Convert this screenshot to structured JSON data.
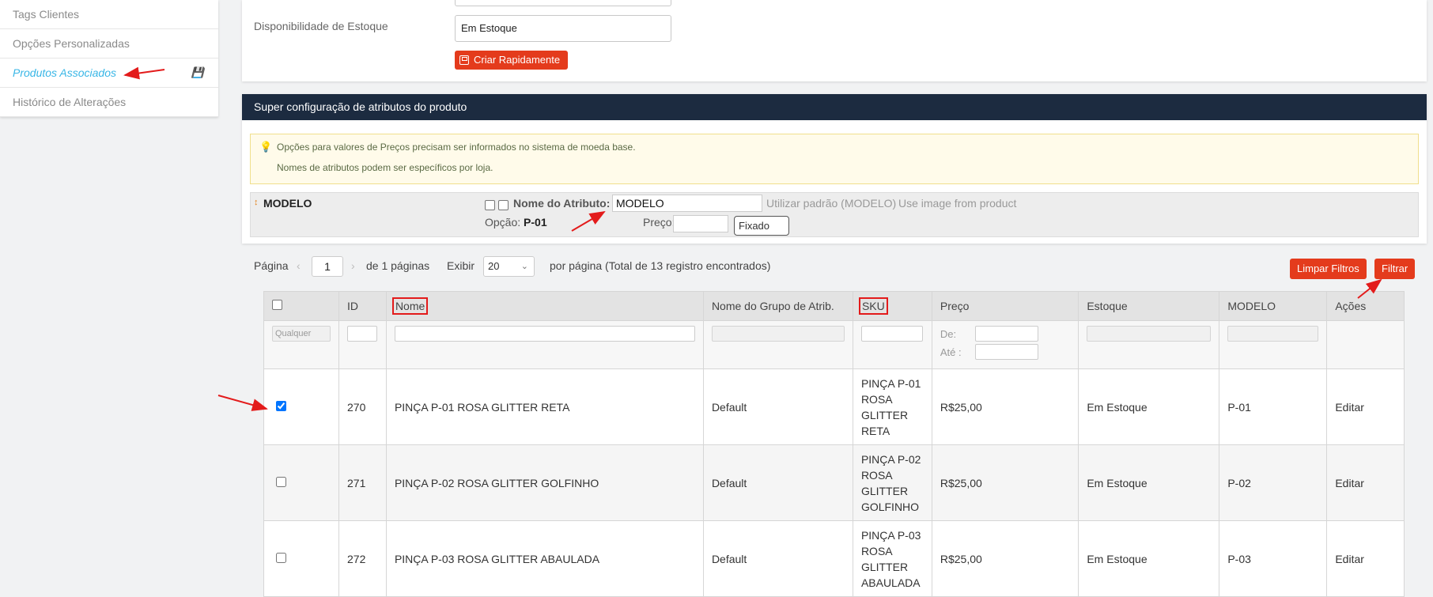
{
  "sidebar": {
    "items": [
      {
        "label": "Tags Clientes"
      },
      {
        "label": "Opções Personalizadas"
      },
      {
        "label": "Produtos Associados",
        "active": true
      },
      {
        "label": "Histórico de Alterações"
      }
    ]
  },
  "form": {
    "stock_label": "Disponibilidade de Estoque",
    "stock_value": "Em Estoque",
    "quick_create_label": "Criar Rapidamente"
  },
  "super_config": {
    "title": "Super configuração de atributos do produto",
    "notice_line1": "Opções para valores de Preços precisam ser informados no sistema de moeda base.",
    "notice_line2": "Nomes de atributos podem ser específicos por loja.",
    "attribute": {
      "name": "MODELO",
      "name_label": "Nome do Atributo:",
      "name_value": "MODELO",
      "use_default": "Utilizar padrão (MODELO)",
      "use_image": "Use image from product",
      "option_label": "Opção:",
      "option_value": "P-01",
      "price_label": "Preço:",
      "price_type": "Fixado"
    }
  },
  "pager": {
    "page_label": "Página",
    "page_value": "1",
    "of_pages": "de 1 páginas",
    "show_label": "Exibir",
    "per_page": "20",
    "per_page_suffix": "por página (Total de 13 registro encontrados)"
  },
  "buttons": {
    "clear_filters": "Limpar Filtros",
    "filter": "Filtrar"
  },
  "grid": {
    "columns": {
      "id": "ID",
      "name": "Nome",
      "attr_group": "Nome do Grupo de Atrib.",
      "sku": "SKU",
      "price": "Preço",
      "stock": "Estoque",
      "model": "MODELO",
      "actions": "Ações"
    },
    "filters": {
      "any_placeholder": "Qualquer",
      "price_from": "De:",
      "price_to": "Até :"
    },
    "rows": [
      {
        "checked": true,
        "id": "270",
        "name": "PINÇA P-01 ROSA GLITTER RETA",
        "attr_group": "Default",
        "sku": "PINÇA P-01 ROSA GLITTER RETA",
        "price": "R$25,00",
        "stock": "Em Estoque",
        "model": "P-01",
        "action": "Editar"
      },
      {
        "checked": false,
        "id": "271",
        "name": "PINÇA P-02 ROSA GLITTER GOLFINHO",
        "attr_group": "Default",
        "sku": "PINÇA P-02 ROSA GLITTER GOLFINHO",
        "price": "R$25,00",
        "stock": "Em Estoque",
        "model": "P-02",
        "action": "Editar"
      },
      {
        "checked": false,
        "id": "272",
        "name": "PINÇA P-03 ROSA GLITTER ABAULADA",
        "attr_group": "Default",
        "sku": "PINÇA P-03 ROSA GLITTER ABAULADA",
        "price": "R$25,00",
        "stock": "Em Estoque",
        "model": "P-03",
        "action": "Editar"
      }
    ]
  },
  "colors": {
    "accent_red": "#e43b1c",
    "header_navy": "#1c2b40",
    "link_blue": "#38b6e6"
  }
}
